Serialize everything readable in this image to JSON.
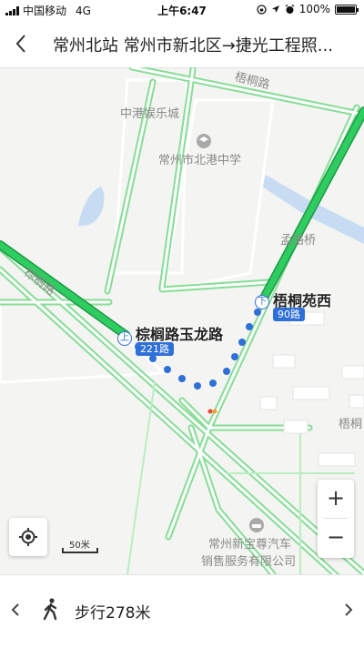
{
  "status_bar": {
    "carrier": "中国移动",
    "network": "4G",
    "time": "上午6:47",
    "battery": "100%"
  },
  "header": {
    "title": "常州北站 常州市新北区→捷光工程照..."
  },
  "map": {
    "labels": {
      "entertainment": "中港娱乐城",
      "school": "常州市北港中学",
      "bridge": "孟骆桥",
      "road_wutong": "梧桐路",
      "road_zonglv": "棕榈路",
      "area_wutong": "梧桐",
      "dealer_line1": "常州新宝尊汽车",
      "dealer_line2": "销售服务有限公司"
    },
    "stops": [
      {
        "name": "棕榈路玉龙路",
        "marker": "上",
        "route": "221路"
      },
      {
        "name": "梧桐苑西",
        "marker": "下",
        "route": "90路"
      }
    ],
    "scale_label": "50米",
    "colors": {
      "bus_route": "#2ecc61",
      "walk_dots": "#2f6fd8",
      "road_green": "#9fe6ab",
      "water": "#c7dcf3"
    }
  },
  "controls": {
    "zoom_in": "+",
    "zoom_out": "−"
  },
  "bottom": {
    "step": "步行278米"
  }
}
